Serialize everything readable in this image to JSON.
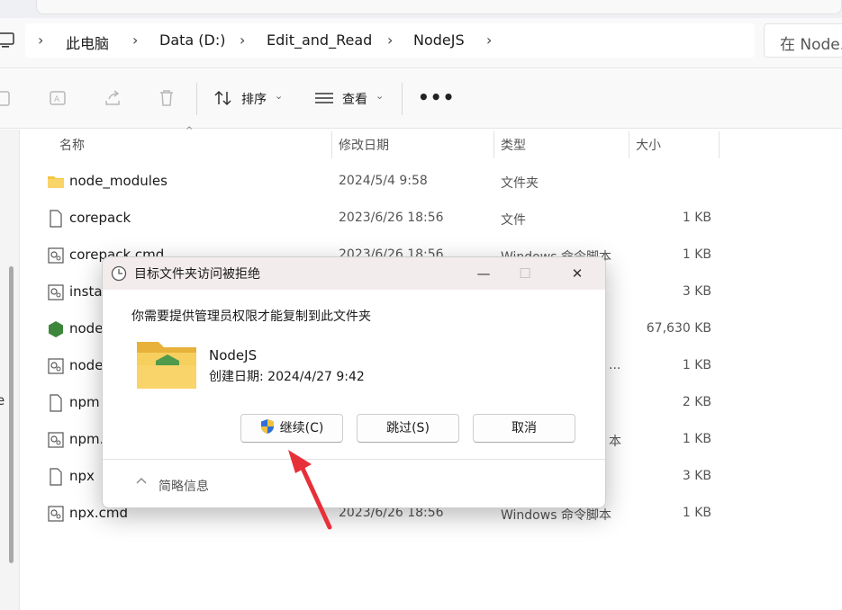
{
  "address": {
    "crumbs": [
      "此电脑",
      "Data (D:)",
      "Edit_and_Read",
      "NodeJS"
    ],
    "search_placeholder": "在 Node..."
  },
  "toolbar": {
    "sort_label": "排序",
    "view_label": "查看",
    "more_label": "•••"
  },
  "columns": {
    "name": "名称",
    "date": "修改日期",
    "type": "类型",
    "size": "大小"
  },
  "files": [
    {
      "name": "node_modules",
      "date": "2024/5/4 9:58",
      "type": "文件夹",
      "size": "",
      "icon": "folder-icon"
    },
    {
      "name": "corepack",
      "date": "2023/6/26 18:56",
      "type": "文件",
      "size": "1 KB",
      "icon": "file-icon"
    },
    {
      "name": "corepack.cmd",
      "date": "2023/6/26 18:56",
      "type": "Windows 命令脚本",
      "size": "1 KB",
      "icon": "cmd-file-icon"
    },
    {
      "name": "insta",
      "date": "",
      "type": "",
      "size": "3 KB",
      "icon": "cmd-file-icon"
    },
    {
      "name": "node",
      "date": "",
      "type": "",
      "size": "67,630 KB",
      "icon": "nodejs-icon"
    },
    {
      "name": "node",
      "date": "",
      "type": "...",
      "size": "1 KB",
      "icon": "cmd-file-icon"
    },
    {
      "name": "npm",
      "date": "",
      "type": "",
      "size": "2 KB",
      "icon": "file-icon"
    },
    {
      "name": "npm.",
      "date": "",
      "type": "本",
      "size": "1 KB",
      "icon": "cmd-file-icon"
    },
    {
      "name": "npx",
      "date": "",
      "type": "",
      "size": "3 KB",
      "icon": "file-icon"
    },
    {
      "name": "npx.cmd",
      "date": "2023/6/26 18:56",
      "type": "Windows 命令脚本",
      "size": "1 KB",
      "icon": "cmd-file-icon"
    }
  ],
  "leftnav": {
    "partial_label": "e"
  },
  "dialog": {
    "title": "目标文件夹访问被拒绝",
    "minimize": "—",
    "maximize": "☐",
    "close": "✕",
    "message": "你需要提供管理员权限才能复制到此文件夹",
    "folder_name": "NodeJS",
    "folder_created": "创建日期: 2024/4/27 9:42",
    "continue_label": "继续(C)",
    "skip_label": "跳过(S)",
    "cancel_label": "取消",
    "details_label": "简略信息"
  },
  "colors": {
    "annotation_arrow": "#e8303a",
    "folder_yellow": "#f5c542",
    "node_green": "#3c873a"
  }
}
